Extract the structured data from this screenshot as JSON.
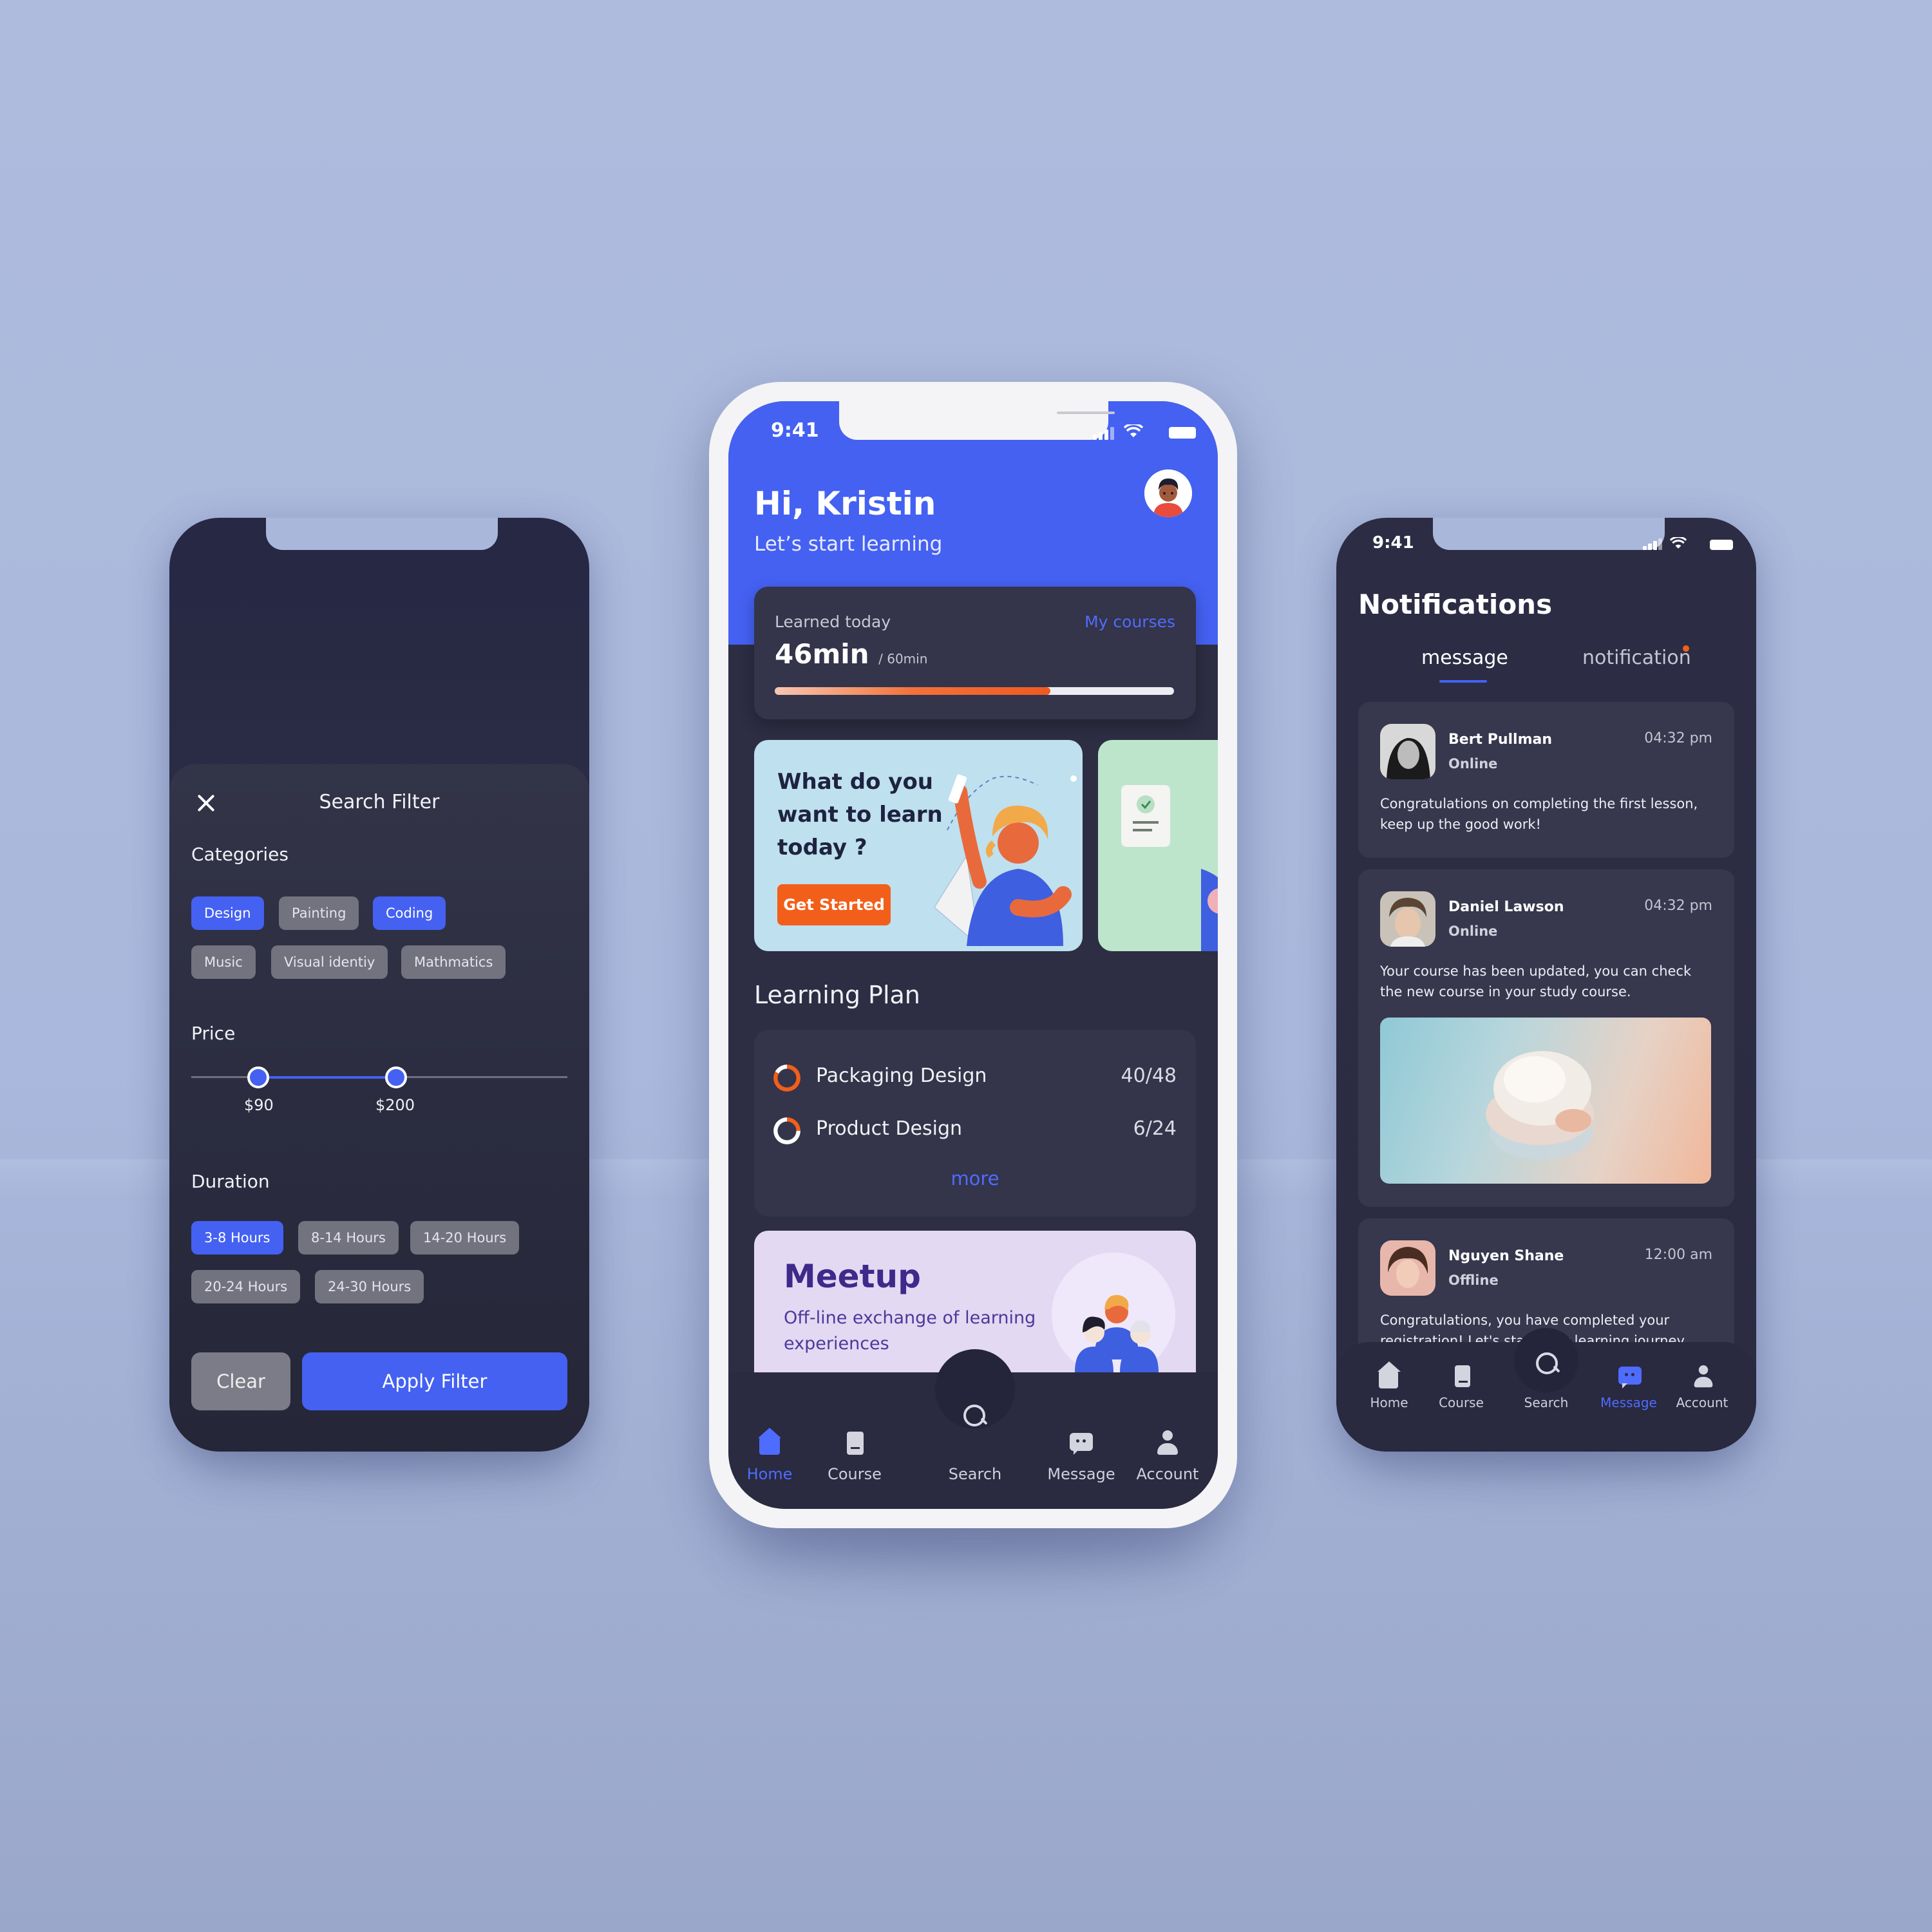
{
  "colors": {
    "accent": "#4461f2",
    "orange": "#f25f1a",
    "dark": "#2d2d43"
  },
  "filter": {
    "title": "Search Filter",
    "categories_label": "Categories",
    "categories": [
      {
        "label": "Design",
        "active": true
      },
      {
        "label": "Painting",
        "active": false
      },
      {
        "label": "Coding",
        "active": true
      },
      {
        "label": "Music",
        "active": false
      },
      {
        "label": "Visual identiy",
        "active": false
      },
      {
        "label": "Mathmatics",
        "active": false
      }
    ],
    "price_label": "Price",
    "price_min": "$90",
    "price_max": "$200",
    "duration_label": "Duration",
    "durations": [
      {
        "label": "3-8 Hours",
        "active": true
      },
      {
        "label": "8-14 Hours",
        "active": false
      },
      {
        "label": "14-20 Hours",
        "active": false
      },
      {
        "label": "20-24 Hours",
        "active": false
      },
      {
        "label": "24-30 Hours",
        "active": false
      }
    ],
    "clear_label": "Clear",
    "apply_label": "Apply Filter"
  },
  "home": {
    "time": "9:41",
    "greeting": "Hi, Kristin",
    "subtitle": "Let’s start learning",
    "learned_label": "Learned today",
    "my_courses": "My courses",
    "learned_value": "46min",
    "learned_goal": "/ 60min",
    "progress": 0.69,
    "promo_text": "What do you want to learn today ?",
    "promo_button": "Get Started",
    "plan_title": "Learning Plan",
    "plan": [
      {
        "name": "Packaging Design",
        "count": "40/48",
        "fraction": 0.83
      },
      {
        "name": "Product Design",
        "count": "6/24",
        "fraction": 0.25
      }
    ],
    "more": "more",
    "meetup_title": "Meetup",
    "meetup_sub": "Off-line exchange of learning experiences",
    "tabs": [
      {
        "label": "Home",
        "icon": "home-icon",
        "active": true
      },
      {
        "label": "Course",
        "icon": "book-icon",
        "active": false
      },
      {
        "label": "Search",
        "icon": "search-icon",
        "active": false
      },
      {
        "label": "Message",
        "icon": "message-icon",
        "active": false
      },
      {
        "label": "Account",
        "icon": "user-icon",
        "active": false
      }
    ]
  },
  "notifications": {
    "time": "9:41",
    "title": "Notifications",
    "tab_message": "message",
    "tab_notification": "notification",
    "messages": [
      {
        "name": "Bert Pullman",
        "status": "Online",
        "time": "04:32 pm",
        "text": "Congratulations on completing the first lesson, keep up the good work!"
      },
      {
        "name": "Daniel Lawson",
        "status": "Online",
        "time": "04:32 pm",
        "text": "Your course has been updated, you can check the new course in your study course."
      },
      {
        "name": "Nguyen Shane",
        "status": "Offline",
        "time": "12:00 am",
        "text": "Congratulations, you have completed your registration! Let's start your learning journey next."
      }
    ],
    "tabs": [
      {
        "label": "Home",
        "icon": "home-icon",
        "active": false
      },
      {
        "label": "Course",
        "icon": "book-icon",
        "active": false
      },
      {
        "label": "Search",
        "icon": "search-icon",
        "active": false
      },
      {
        "label": "Message",
        "icon": "message-icon",
        "active": true
      },
      {
        "label": "Account",
        "icon": "user-icon",
        "active": false
      }
    ]
  }
}
